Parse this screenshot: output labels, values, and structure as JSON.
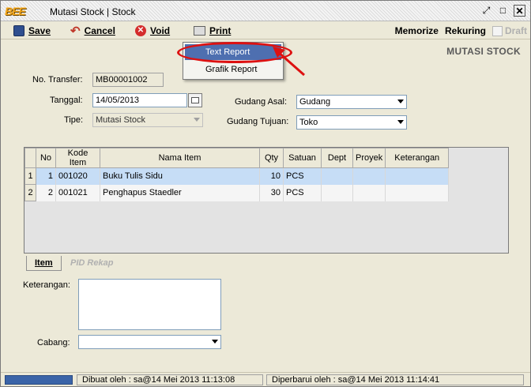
{
  "window": {
    "logo": "BEE",
    "title": "Mutasi Stock | Stock",
    "buttons": [
      "restore",
      "maximize",
      "close"
    ]
  },
  "toolbar": {
    "save_label": "Save",
    "cancel_label": "Cancel",
    "void_label": "Void",
    "print_label": "Print",
    "memorize_label": "Memorize",
    "rekuring_label": "Rekuring",
    "draft_label": "Draft"
  },
  "print_menu": {
    "items": [
      {
        "label": "Text Report",
        "highlighted": true
      },
      {
        "label": "Grafik Report",
        "highlighted": false
      }
    ]
  },
  "page": {
    "header": "MUTASI STOCK"
  },
  "form": {
    "no_transfer_label": "No. Transfer:",
    "no_transfer_value": "MB00001002",
    "tanggal_label": "Tanggal:",
    "tanggal_value": "14/05/2013",
    "tipe_label": "Tipe:",
    "tipe_value": "Mutasi Stock",
    "gudang_asal_label": "Gudang Asal:",
    "gudang_asal_value": "Gudang",
    "gudang_tujuan_label": "Gudang Tujuan:",
    "gudang_tujuan_value": "Toko",
    "keterangan_label": "Keterangan:",
    "cabang_label": "Cabang:"
  },
  "table": {
    "columns": [
      "No",
      "Kode Item",
      "Nama Item",
      "Qty",
      "Satuan",
      "Dept",
      "Proyek",
      "Keterangan"
    ],
    "rows": [
      {
        "rownum": "1",
        "no": "1",
        "kode": "001020",
        "nama": "Buku Tulis Sidu",
        "qty": "10",
        "satuan": "PCS",
        "dept": "",
        "proyek": "",
        "ket": ""
      },
      {
        "rownum": "2",
        "no": "2",
        "kode": "001021",
        "nama": "Penghapus Staedler",
        "qty": "30",
        "satuan": "PCS",
        "dept": "",
        "proyek": "",
        "ket": ""
      }
    ]
  },
  "tabs": {
    "item": "Item",
    "pid_rekap": "PID Rekap"
  },
  "status": {
    "dibuat": "Dibuat oleh : sa@14 Mei 2013  11:13:08",
    "diperbarui": "Diperbarui oleh : sa@14 Mei 2013  11:14:41"
  },
  "colors": {
    "accent": "#4e6fb0",
    "selection": "#c6ddf6",
    "annotation": "#dd1111"
  }
}
